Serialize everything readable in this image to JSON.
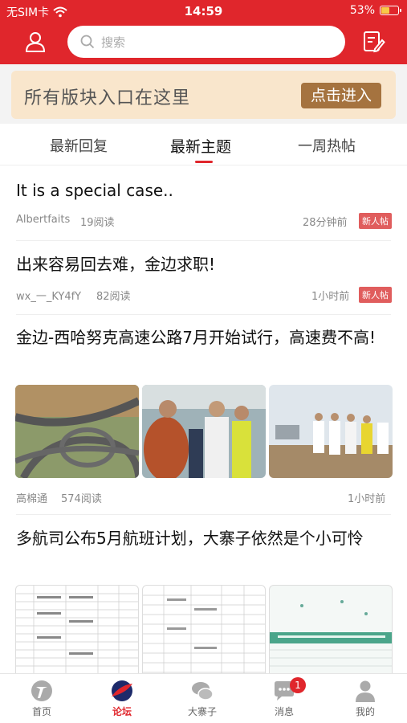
{
  "status_bar": {
    "carrier": "无SIM卡",
    "time": "14:59",
    "battery": "53%",
    "battery_level": 0.53
  },
  "header": {
    "search_placeholder": "搜索"
  },
  "banner": {
    "text": "所有版块入口在这里",
    "button": "点击进入"
  },
  "tabs": [
    {
      "label": "最新回复"
    },
    {
      "label": "最新主题"
    },
    {
      "label": "一周热帖"
    }
  ],
  "posts": [
    {
      "title": "It is a special case..",
      "author": "Albertfaits",
      "reads": "19阅读",
      "time": "28分钟前",
      "badge": "新人帖"
    },
    {
      "title": "出来容易回去难，金边求职!",
      "author": "wx_一_KY4fY",
      "reads": "82阅读",
      "time": "1小时前",
      "badge": "新人帖"
    },
    {
      "title": "金边-西哈努克高速公路7月开始试行，高速费不高!",
      "author": "高棉通",
      "reads": "574阅读",
      "time": "1小时前"
    },
    {
      "title": "多航司公布5月航班计划，大寨子依然是个小可怜"
    }
  ],
  "bottom_nav": [
    {
      "label": "首页"
    },
    {
      "label": "论坛"
    },
    {
      "label": "大寨子"
    },
    {
      "label": "消息",
      "badge": "1"
    },
    {
      "label": "我的"
    }
  ],
  "colors": {
    "brand_red": "#e0262c",
    "banner_bg": "#f9e6cc",
    "banner_button": "#a5733f"
  }
}
